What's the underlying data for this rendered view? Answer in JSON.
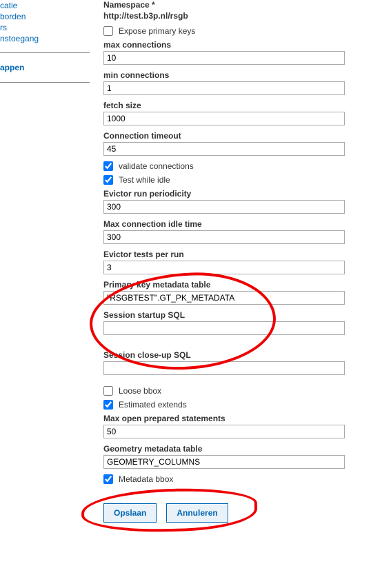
{
  "sidebar": {
    "items": [
      {
        "label": "catie"
      },
      {
        "label": "borden"
      },
      {
        "label": "rs"
      },
      {
        "label": "nstoegang"
      }
    ],
    "heading": "appen"
  },
  "namespace": {
    "label": "Namespace *",
    "value": "http://test.b3p.nl/rsgb"
  },
  "expose_pk": {
    "label": "Expose primary keys",
    "checked": false
  },
  "max_connections": {
    "label": "max connections",
    "value": "10"
  },
  "min_connections": {
    "label": "min connections",
    "value": "1"
  },
  "fetch_size": {
    "label": "fetch size",
    "value": "1000"
  },
  "conn_timeout": {
    "label": "Connection timeout",
    "value": "45"
  },
  "validate_conn": {
    "label": "validate connections",
    "checked": true
  },
  "test_while_idle": {
    "label": "Test while idle",
    "checked": true
  },
  "evictor_periodicity": {
    "label": "Evictor run periodicity",
    "value": "300"
  },
  "max_idle": {
    "label": "Max connection idle time",
    "value": "300"
  },
  "evictor_tests": {
    "label": "Evictor tests per run",
    "value": "3"
  },
  "pk_metadata": {
    "label": "Primary key metadata table",
    "value": "\"RSGBTEST\".GT_PK_METADATA"
  },
  "session_startup": {
    "label": "Session startup SQL",
    "value": ""
  },
  "session_closeup": {
    "label": "Session close-up SQL",
    "value": ""
  },
  "loose_bbox": {
    "label": "Loose bbox",
    "checked": false
  },
  "estimated_extends": {
    "label": "Estimated extends",
    "checked": true
  },
  "max_prepared": {
    "label": "Max open prepared statements",
    "value": "50"
  },
  "geom_metadata": {
    "label": "Geometry metadata table",
    "value": "GEOMETRY_COLUMNS"
  },
  "metadata_bbox": {
    "label": "Metadata bbox",
    "checked": true
  },
  "buttons": {
    "save": "Opslaan",
    "cancel": "Annuleren"
  }
}
